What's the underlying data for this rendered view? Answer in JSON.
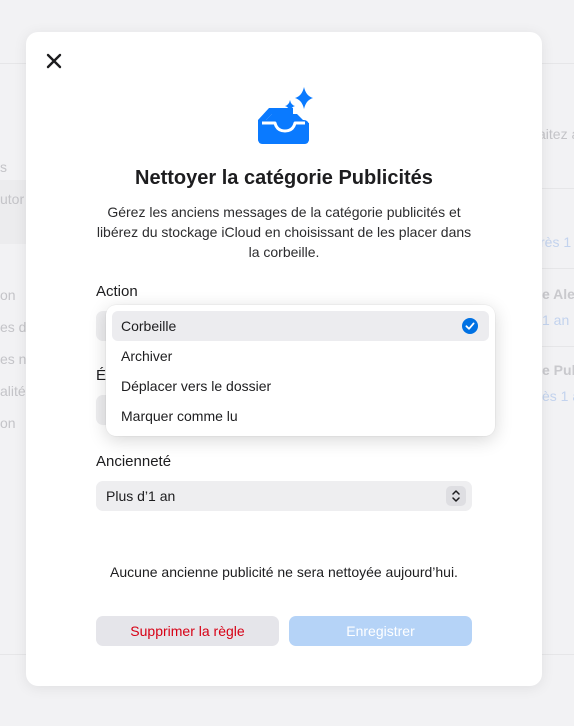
{
  "background": {
    "left_fragments": [
      "s",
      "utor",
      "on",
      "es de",
      "es n",
      "alité",
      "on"
    ],
    "right_fragments": [
      {
        "text": "aitez a",
        "style": "plain"
      },
      {
        "text": "rès 1 a",
        "style": "blue"
      },
      {
        "text": "e Aler",
        "style": "bold"
      },
      {
        "text": "1 an",
        "style": "blue"
      },
      {
        "text": "e Publ",
        "style": "bold"
      },
      {
        "text": "ès 1 a",
        "style": "blue"
      }
    ],
    "hidden_label_fragment": "É"
  },
  "modal": {
    "title": "Nettoyer la catégorie Publicités",
    "description": "Gérez les anciens messages de la catégorie publicités et libérez du stockage iCloud en choisissant de les placer dans la corbeille.",
    "action": {
      "label": "Action",
      "options": [
        "Corbeille",
        "Archiver",
        "Déplacer vers le dossier",
        "Marquer comme lu"
      ],
      "selected": "Corbeille"
    },
    "age": {
      "label": "Ancienneté",
      "value": "Plus d’1 an"
    },
    "empty_note": "Aucune ancienne publicité ne sera nettoyée aujourd’hui.",
    "buttons": {
      "delete": "Supprimer la règle",
      "save": "Enregistrer"
    }
  },
  "colors": {
    "accent": "#0071e3",
    "destructive": "#d70015",
    "save_disabled_bg": "#b5d3f7"
  },
  "icons": {
    "close": "close-icon",
    "hero": "tray-sparkle-icon",
    "check": "checkmark-circle-icon",
    "stepper": "chevron-up-down-icon"
  }
}
